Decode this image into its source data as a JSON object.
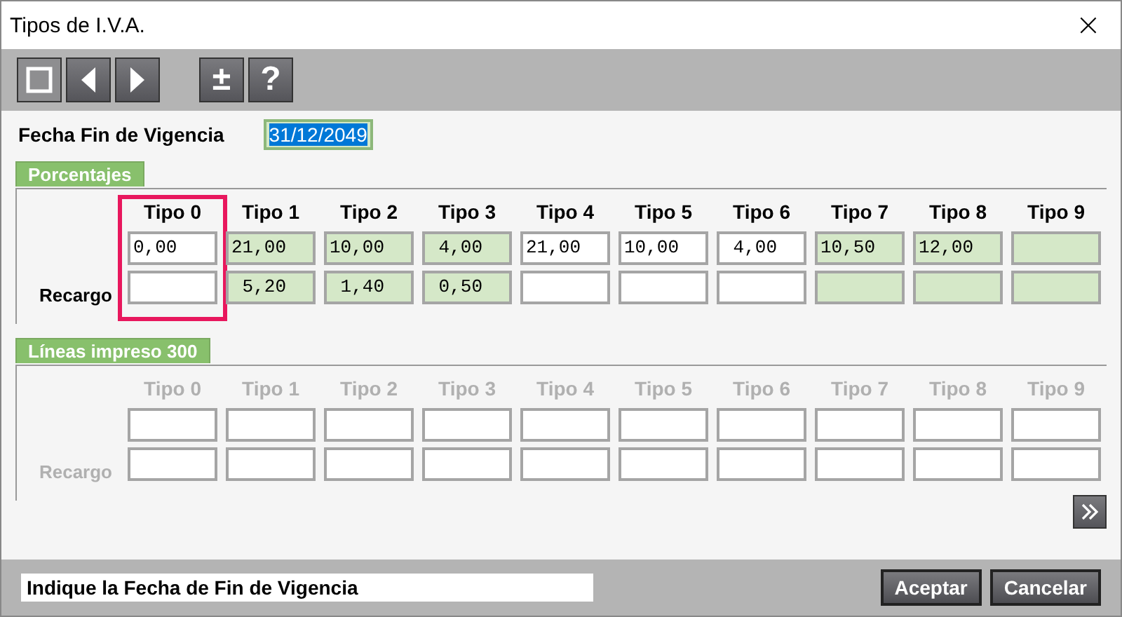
{
  "window": {
    "title": "Tipos de I.V.A.",
    "close": "×"
  },
  "toolbar": [
    {
      "kind": "stop",
      "disabled": true
    },
    {
      "kind": "prev",
      "disabled": false
    },
    {
      "kind": "next",
      "disabled": false
    },
    {
      "kind": "text",
      "label": "±",
      "disabled": false
    },
    {
      "kind": "text",
      "label": "?",
      "disabled": false
    }
  ],
  "fecha": {
    "label": "Fecha Fin de Vigencia",
    "value": "31/12/2049",
    "selected": true
  },
  "porcentajes": {
    "title": "Porcentajes",
    "row_label": "Recargo",
    "disabled": false,
    "columns": [
      {
        "label": "Tipo 0",
        "highlighted": true,
        "value": "0,00",
        "value_disabled": false,
        "recargo_disabled": false
      },
      {
        "label": "Tipo 1",
        "highlighted": false,
        "value": "21,00",
        "value_disabled": true,
        "recargo": " 5,20",
        "recargo_disabled": true
      },
      {
        "label": "Tipo 2",
        "highlighted": false,
        "value": "10,00",
        "value_disabled": true,
        "recargo": " 1,40",
        "recargo_disabled": true
      },
      {
        "label": "Tipo 3",
        "highlighted": false,
        "value": " 4,00",
        "value_disabled": true,
        "recargo": " 0,50",
        "recargo_disabled": true
      },
      {
        "label": "Tipo 4",
        "highlighted": false,
        "value": "21,00",
        "value_disabled": false,
        "recargo_disabled": false
      },
      {
        "label": "Tipo 5",
        "highlighted": false,
        "value": "10,00",
        "value_disabled": false,
        "recargo_disabled": false
      },
      {
        "label": "Tipo 6",
        "highlighted": false,
        "value": " 4,00",
        "value_disabled": false,
        "recargo_disabled": false
      },
      {
        "label": "Tipo 7",
        "highlighted": false,
        "value": "10,50",
        "value_disabled": true,
        "recargo_disabled": true
      },
      {
        "label": "Tipo 8",
        "highlighted": false,
        "value": "12,00",
        "value_disabled": true,
        "recargo_disabled": true
      },
      {
        "label": "Tipo 9",
        "highlighted": false,
        "value_disabled": true,
        "recargo_disabled": true
      }
    ]
  },
  "lineas": {
    "title": "Líneas impreso 300",
    "row_label": "Recargo",
    "disabled": true,
    "columns": [
      {
        "label": "Tipo 0",
        "highlighted": false,
        "value_disabled": false,
        "recargo_disabled": false
      },
      {
        "label": "Tipo 1",
        "highlighted": false,
        "value_disabled": false,
        "recargo_disabled": false
      },
      {
        "label": "Tipo 2",
        "highlighted": false,
        "value_disabled": false,
        "recargo_disabled": false
      },
      {
        "label": "Tipo 3",
        "highlighted": false,
        "value_disabled": false,
        "recargo_disabled": false
      },
      {
        "label": "Tipo 4",
        "highlighted": false,
        "value_disabled": false,
        "recargo_disabled": false
      },
      {
        "label": "Tipo 5",
        "highlighted": false,
        "value_disabled": false,
        "recargo_disabled": false
      },
      {
        "label": "Tipo 6",
        "highlighted": false,
        "value_disabled": false,
        "recargo_disabled": false
      },
      {
        "label": "Tipo 7",
        "highlighted": false,
        "value_disabled": false,
        "recargo_disabled": false
      },
      {
        "label": "Tipo 8",
        "highlighted": false,
        "value_disabled": false,
        "recargo_disabled": false
      },
      {
        "label": "Tipo 9",
        "highlighted": false,
        "value_disabled": false,
        "recargo_disabled": false
      }
    ]
  },
  "status": "Indique la Fecha de Fin de Vigencia",
  "buttons": [
    "Aceptar",
    "Cancelar"
  ]
}
